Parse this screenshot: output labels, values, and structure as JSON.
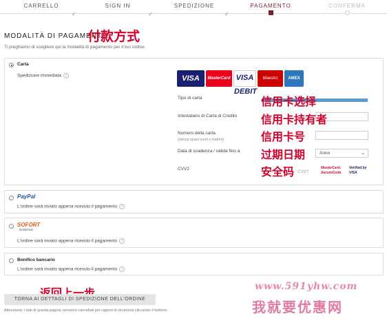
{
  "steps": [
    {
      "label": "CARRELLO",
      "done_mark": "✓"
    },
    {
      "label": "SIGN IN",
      "done_mark": "✓"
    },
    {
      "label": "SPEDIZIONE",
      "done_mark": "✓"
    },
    {
      "label": "PAGAMENTO"
    },
    {
      "label": "CONFERMA"
    }
  ],
  "colors": {
    "accent": "#7a1f2b",
    "annotation": "#d4002a"
  },
  "page": {
    "title": "MODALITÀ DI PAGAMENTO",
    "title_note": "付款方式",
    "subtitle": "Ti preghiamo di scegliere qui la modalità di pagamento per il tuo ordine."
  },
  "card_option": {
    "label": "Carta",
    "shipping": "Spedizione immediata",
    "logos": [
      "VISA",
      "MasterCard",
      "VISA DEBIT",
      "Maestro",
      "AMEX"
    ],
    "fields": {
      "type_label": "Tipo di carta",
      "type_note": "信用卡选择",
      "holder_label": "Intestatario di Carta di Credito",
      "holder_note": "信用卡持有者",
      "number_label": "Numero della carta",
      "number_hint": "(senza spazi vuoti o trattini)",
      "number_note": "信用卡号",
      "expiry_label": "Data di scadenza / valida fino a",
      "expiry_note": "过期日期",
      "year_placeholder": "Anno",
      "cvv_label": "CVV2",
      "cvv_note": "安全码",
      "cvv_fragment": "CV2?",
      "badge_mc": "MasterCard. SecureCode.",
      "badge_visa": "Verified by VISA"
    }
  },
  "paypal_option": {
    "label": "PayPal",
    "text": "L'ordine sarà inviato appena ricevuto il pagamento"
  },
  "sofort_option": {
    "label": "SOFORT",
    "sublabel": "BANKING",
    "text": "L'ordine sarà inviato appena ricevuto il pagamento"
  },
  "bank_option": {
    "label": "Bonifico bancario",
    "text": "L'ordine sarà inviato appena ricevuto il pagamento"
  },
  "back": {
    "note": "返回上一步",
    "label": "TORNA AI DETTAGLI DI SPEDIZIONE DELL'ORDINE"
  },
  "footnote": "Attenzione: i dati di questa pagina verranno cancellati per ragioni di sicurezza cliccando il bottone.",
  "watermark": {
    "url": "www.591yhw.com",
    "text": "我就要优惠网"
  }
}
